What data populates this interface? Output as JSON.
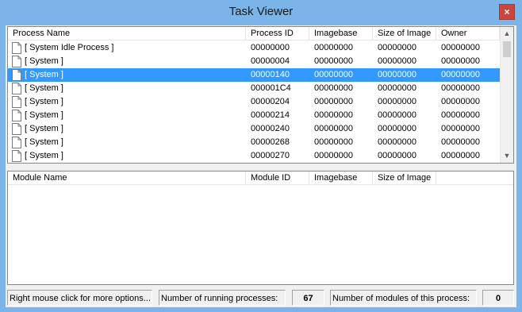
{
  "window": {
    "title": "Task Viewer",
    "close_glyph": "×"
  },
  "process_list": {
    "columns": [
      "Process Name",
      "Process ID",
      "Imagebase",
      "Size of Image",
      "Owner"
    ],
    "rows": [
      {
        "name": "[ System Idle Process ]",
        "pid": "00000000",
        "imagebase": "00000000",
        "size": "00000000",
        "owner": "00000000"
      },
      {
        "name": "[ System ]",
        "pid": "00000004",
        "imagebase": "00000000",
        "size": "00000000",
        "owner": "00000000"
      },
      {
        "name": "[ System ]",
        "pid": "00000140",
        "imagebase": "00000000",
        "size": "00000000",
        "owner": "00000000"
      },
      {
        "name": "[ System ]",
        "pid": "000001C4",
        "imagebase": "00000000",
        "size": "00000000",
        "owner": "00000000"
      },
      {
        "name": "[ System ]",
        "pid": "00000204",
        "imagebase": "00000000",
        "size": "00000000",
        "owner": "00000000"
      },
      {
        "name": "[ System ]",
        "pid": "00000214",
        "imagebase": "00000000",
        "size": "00000000",
        "owner": "00000000"
      },
      {
        "name": "[ System ]",
        "pid": "00000240",
        "imagebase": "00000000",
        "size": "00000000",
        "owner": "00000000"
      },
      {
        "name": "[ System ]",
        "pid": "00000268",
        "imagebase": "00000000",
        "size": "00000000",
        "owner": "00000000"
      },
      {
        "name": "[ System ]",
        "pid": "00000270",
        "imagebase": "00000000",
        "size": "00000000",
        "owner": "00000000"
      }
    ],
    "selected_index": 2
  },
  "module_list": {
    "columns": [
      "Module Name",
      "Module ID",
      "Imagebase",
      "Size of Image"
    ]
  },
  "status_bar": {
    "hint": "Right mouse click for more options...",
    "running_label": "Number of running processes:",
    "running_count": "67",
    "modules_label": "Number of modules of this process:",
    "modules_count": "0"
  },
  "colors": {
    "selection": "#3399ff",
    "title_bar": "#7ab4e8",
    "close_button": "#c9463d"
  },
  "icons": {
    "row_icon": "document-icon",
    "scroll_up": "chevron-up-icon",
    "scroll_down": "chevron-down-icon"
  }
}
